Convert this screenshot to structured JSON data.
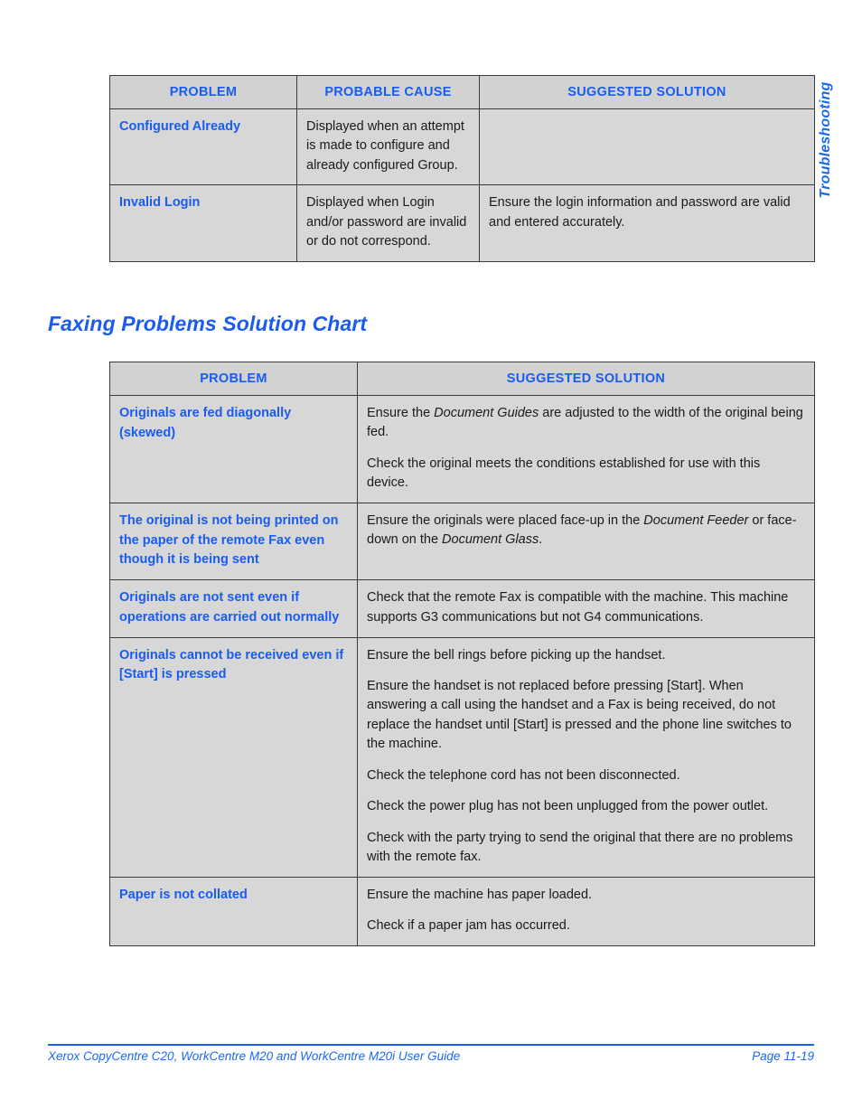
{
  "page": {
    "side_tab_label": "Troubleshooting",
    "accent_color": "#1A5CEF",
    "table_header_bg": "#d2d2d2",
    "table_cell_bg": "#d7d7d7",
    "border_color": "#3b3b3b"
  },
  "table_one": {
    "headers": [
      "PROBLEM",
      "PROBABLE CAUSE",
      "SUGGESTED SOLUTION"
    ],
    "rows": [
      {
        "problem": "Configured Already",
        "cause": "Displayed when an attempt is made to configure and already configured Group.",
        "solution": ""
      },
      {
        "problem": "Invalid Login",
        "cause": "Displayed when Login and/or password are invalid or do not correspond.",
        "solution": "Ensure the login information and password are valid and entered accurately."
      }
    ]
  },
  "section": {
    "heading": "Faxing Problems Solution Chart"
  },
  "table_two": {
    "headers": [
      "PROBLEM",
      "SUGGESTED SOLUTION"
    ],
    "rows": [
      {
        "problem": "Originals are fed diagonally (skewed)",
        "solution_paragraphs": [
          "Ensure the <i>Document Guides</i> are adjusted to the width of the original being fed.",
          "Check the original meets the conditions established for use with this device."
        ]
      },
      {
        "problem": "The original is not being printed on the paper of the remote Fax even though it is being sent",
        "solution_paragraphs": [
          "Ensure the originals were placed face-up in the <i>Document Feeder</i> or face-down on the <i>Document Glass</i>."
        ]
      },
      {
        "problem": "Originals are not sent even if operations are carried out normally",
        "solution_paragraphs": [
          "Check that the remote Fax is compatible with the machine. This machine supports G3 communications but not G4 communications."
        ]
      },
      {
        "problem": "Originals cannot be received even if [Start] is pressed",
        "solution_paragraphs": [
          "Ensure the bell rings before picking up the handset.",
          "Ensure the handset is not replaced before pressing [Start]. When answering a call using the handset and a Fax is being received, do not replace the handset until [Start] is pressed and the phone line switches to the machine.",
          "Check the telephone cord has not been disconnected.",
          "Check the power plug has not been unplugged from the power outlet.",
          "Check with the party trying to send the original that there are no problems with the remote fax."
        ]
      },
      {
        "problem": "Paper is not collated",
        "solution_paragraphs": [
          "Ensure the machine has paper loaded.",
          "Check if a paper jam has occurred."
        ]
      }
    ]
  },
  "footer": {
    "title": "Xerox CopyCentre C20, WorkCentre M20 and WorkCentre M20i User Guide",
    "page_number": "Page 11-19"
  }
}
